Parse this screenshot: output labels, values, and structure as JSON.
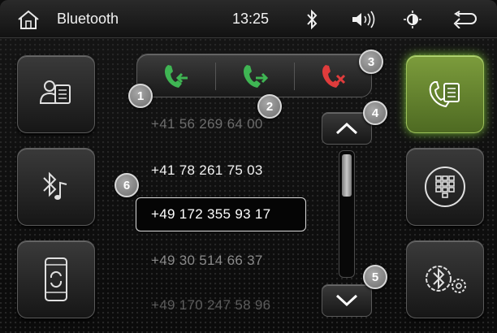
{
  "header": {
    "title": "Bluetooth",
    "time": "13:25",
    "icons": [
      "home-icon",
      "bluetooth-icon",
      "volume-icon",
      "brightness-icon",
      "back-icon"
    ]
  },
  "left_sidebar": {
    "items": [
      {
        "name": "contacts-button",
        "icon": "contacts-icon"
      },
      {
        "name": "bluetooth-music-button",
        "icon": "bluetooth-music-icon"
      },
      {
        "name": "phone-sync-button",
        "icon": "phone-sync-icon"
      }
    ]
  },
  "right_sidebar": {
    "items": [
      {
        "name": "call-list-button",
        "icon": "call-list-icon",
        "active": true
      },
      {
        "name": "keypad-button",
        "icon": "keypad-icon"
      },
      {
        "name": "bluetooth-settings-button",
        "icon": "bluetooth-settings-icon"
      }
    ]
  },
  "call_controls": {
    "buttons": [
      {
        "name": "incoming-calls-button",
        "icon": "incoming-call-icon"
      },
      {
        "name": "outgoing-calls-button",
        "icon": "outgoing-call-icon"
      },
      {
        "name": "missed-calls-button",
        "icon": "missed-call-icon"
      }
    ]
  },
  "call_list": {
    "numbers": [
      "+41 56 269 64 00",
      "+41 78 261 75 03",
      "+49 172 355 93 17",
      "+49 30 514 66 37",
      "+49 170 247 58 96"
    ],
    "selected_index": 2
  },
  "scroll": {
    "thumb_position": 0.0
  },
  "callouts": [
    "1",
    "2",
    "3",
    "4",
    "5",
    "6"
  ],
  "colors": {
    "active_green": "#7c9c3c",
    "call_green": "#3fb553",
    "call_red": "#e03c3c",
    "text_bright": "#ffffff",
    "text_dim": "#6c6c6c"
  }
}
